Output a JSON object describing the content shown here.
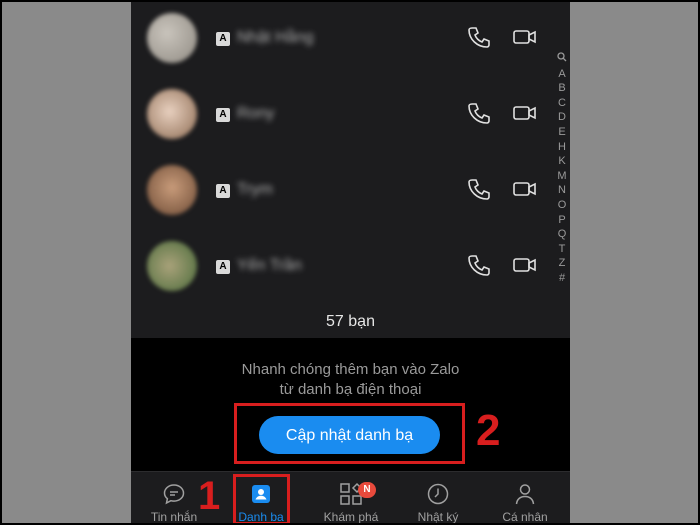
{
  "contacts": [
    {
      "badge": "A",
      "name": "Nhật Hằng"
    },
    {
      "badge": "A",
      "name": "Rony"
    },
    {
      "badge": "A",
      "name": "Trym"
    },
    {
      "badge": "A",
      "name": "Yến Trần"
    }
  ],
  "index_letters": [
    "A",
    "B",
    "C",
    "D",
    "E",
    "H",
    "K",
    "M",
    "N",
    "O",
    "P",
    "Q",
    "T",
    "Z",
    "#"
  ],
  "friend_count": "57 bạn",
  "invite": {
    "line1": "Nhanh chóng thêm bạn vào Zalo",
    "line2": "từ danh bạ điện thoại",
    "button": "Cập nhật danh bạ"
  },
  "tabs": [
    {
      "label": "Tin nhắn",
      "icon": "chat-bubble-icon"
    },
    {
      "label": "Danh ba",
      "icon": "contacts-icon",
      "active": true
    },
    {
      "label": "Khám phá",
      "icon": "discover-grid-icon",
      "badge": "N"
    },
    {
      "label": "Nhật ký",
      "icon": "clock-icon"
    },
    {
      "label": "Cá nhân",
      "icon": "profile-icon"
    }
  ],
  "annotations": {
    "one": "1",
    "two": "2"
  },
  "colors": {
    "accent": "#1a8cf0",
    "highlight": "#d81e1e",
    "badge": "#e84a3c"
  }
}
